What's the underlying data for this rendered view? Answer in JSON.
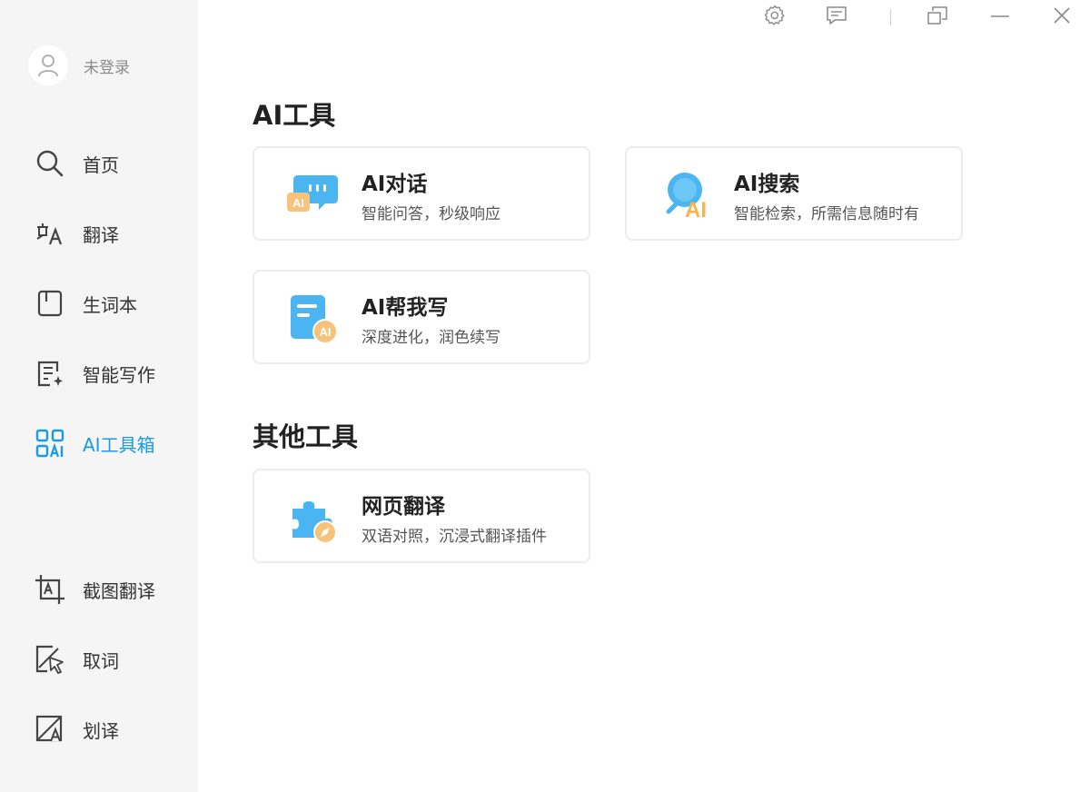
{
  "user": {
    "name": "未登录"
  },
  "nav": {
    "home": "首页",
    "translate": "翻译",
    "vocabulary": "生词本",
    "writing": "智能写作",
    "ai_toolbox": "AI工具箱",
    "screenshot_translate": "截图翻译",
    "word_pick": "取词",
    "selection_translate": "划译"
  },
  "sections": {
    "ai_tools": "AI工具",
    "other_tools": "其他工具"
  },
  "cards": {
    "ai_chat": {
      "title": "AI对话",
      "desc": "智能问答，秒级响应"
    },
    "ai_search": {
      "title": "AI搜索",
      "desc": "智能检索，所需信息随时有"
    },
    "ai_write": {
      "title": "AI帮我写",
      "desc": "深度进化，润色续写"
    },
    "web_translate": {
      "title": "网页翻译",
      "desc": "双语对照，沉浸式翻译插件"
    }
  },
  "icons": {
    "ai_chat_icon_text": "AI",
    "ai_search_icon_text": "AI",
    "ai_write_icon_text": "AI"
  },
  "colors": {
    "accent": "#1a9ae6",
    "sidebar_bg": "#f5f5f5",
    "icon_blue": "#4ab5f0",
    "icon_orange": "#f7c27a"
  }
}
